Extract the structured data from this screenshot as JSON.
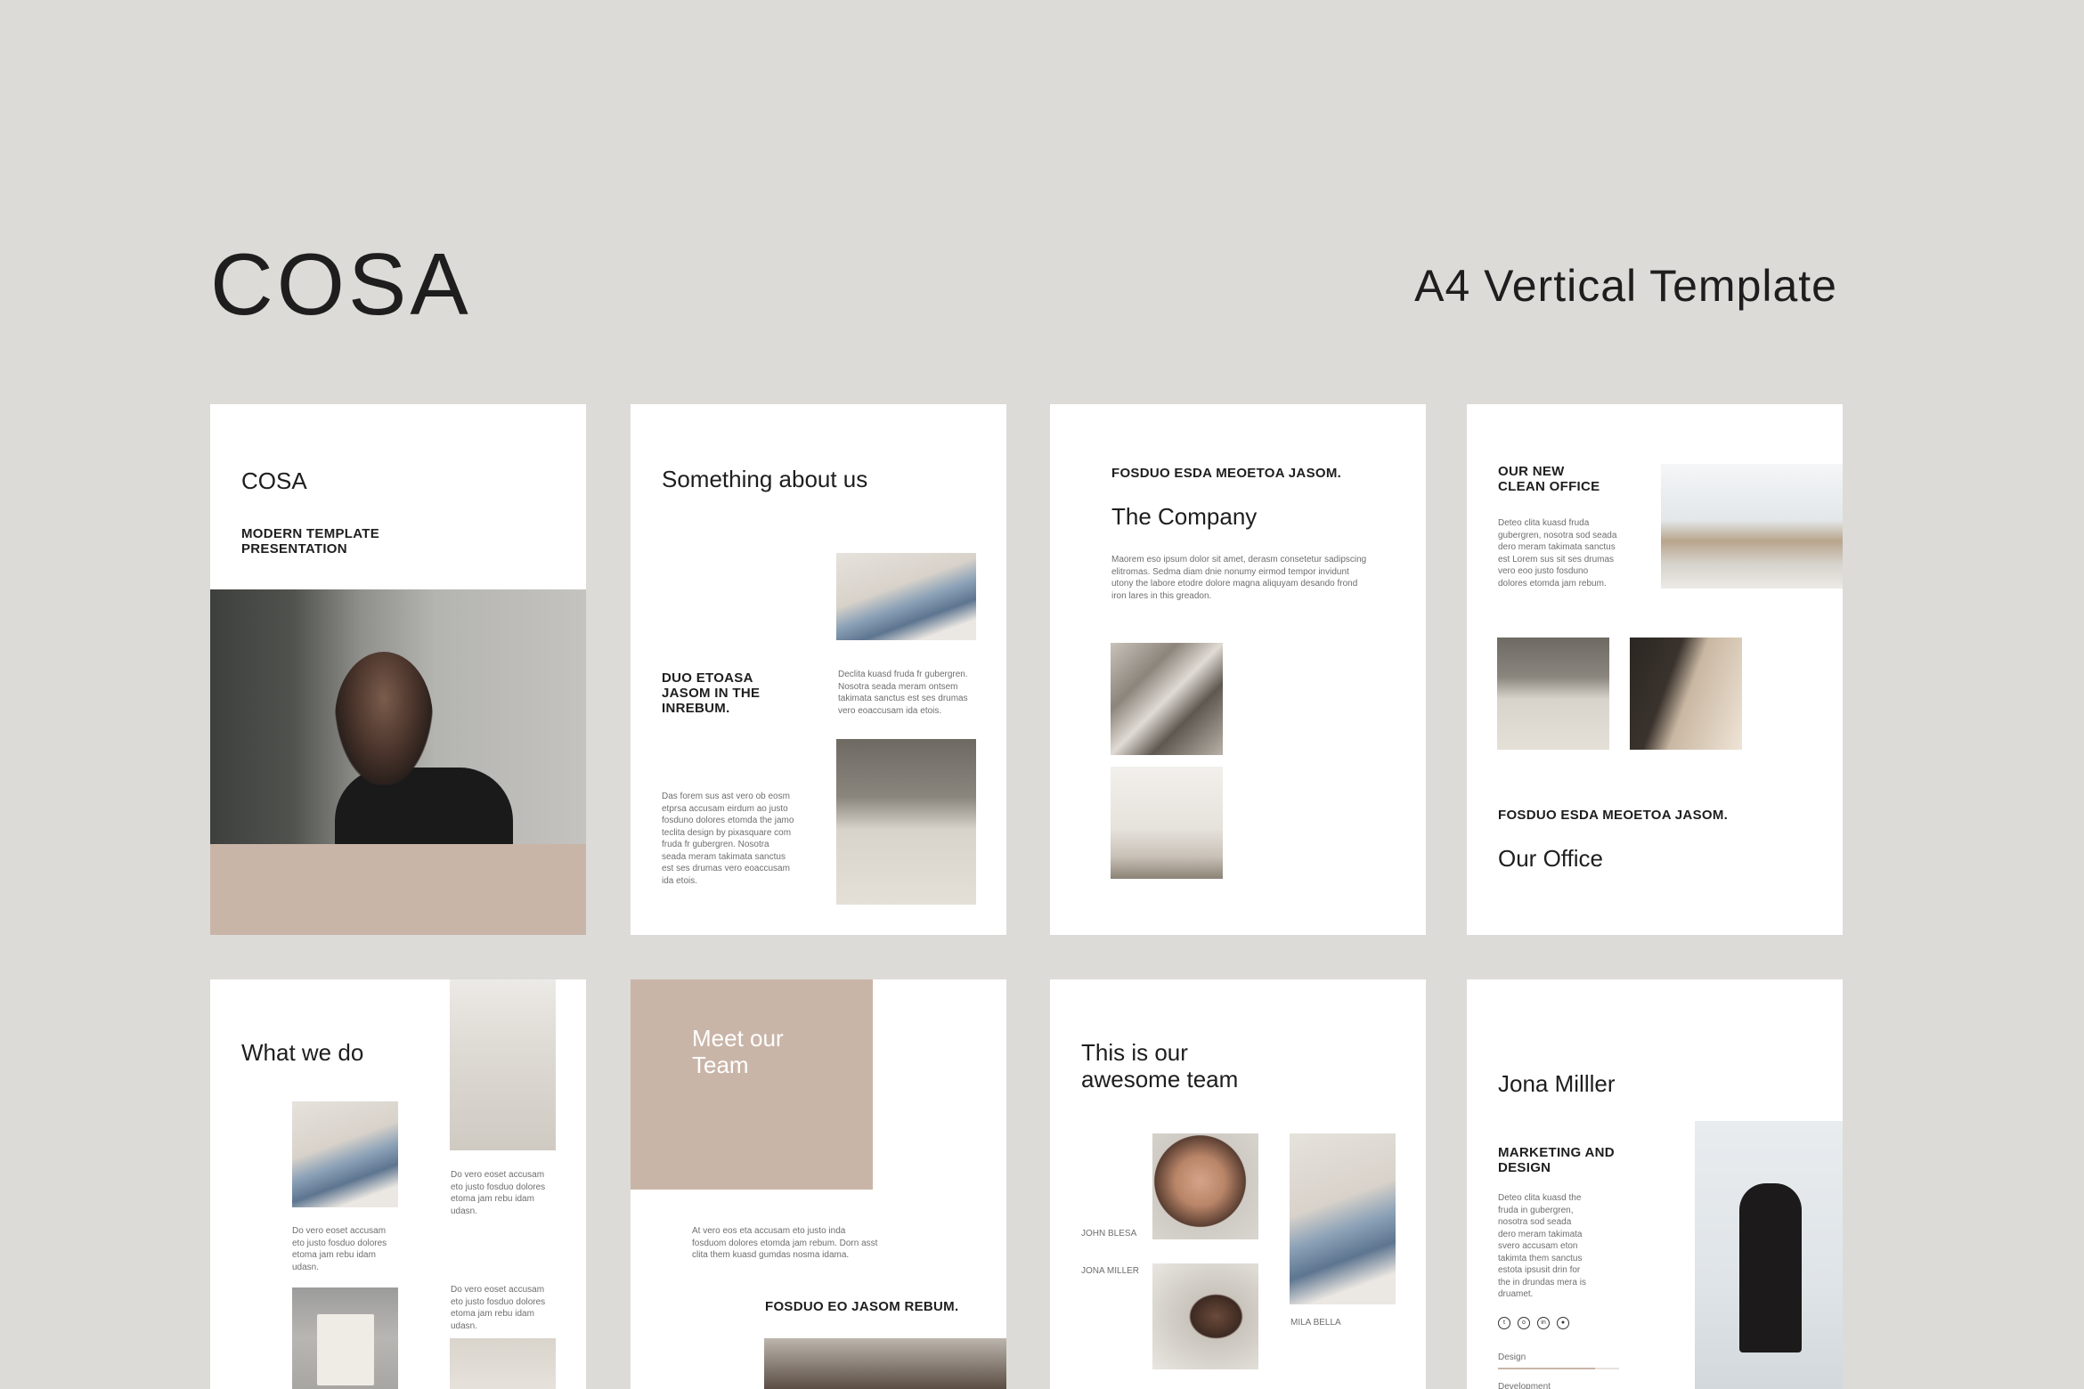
{
  "header": {
    "brand": "COSA",
    "subtitle": "A4 Vertical Template"
  },
  "pages": {
    "cover": {
      "title": "COSA",
      "subtitle": "MODERN TEMPLATE PRESENTATION",
      "accent": "#c9b5a8"
    },
    "about": {
      "title": "Something about us",
      "heading": "DUO ETOASA JASOM IN THE INREBUM.",
      "body_right": "Declita kuasd fruda fr gubergren. Nosotra seada meram ontsem takimata sanctus est ses drumas vero eoaccusam ida etois.",
      "body_left": "Das forem sus ast vero ob eosm etprsa accusam eirdum ao justo fosduno dolores etomda the jamo teclita design by pixasquare com fruda fr gubergren. Nosotra seada meram takimata sanctus est ses drumas vero eoaccusam ida etois."
    },
    "company": {
      "kicker": "FOSDUO ESDA MEOETOA JASOM.",
      "title": "The Company",
      "body": "Maorem eso ipsum dolor sit amet, derasm consetetur sadipscing elitromas. Sedma diam dnie nonumy eirmod tempor invidunt utony the labore etodre dolore magna aliquyam desando frond iron lares in this greadon."
    },
    "office": {
      "kicker_top": "OUR NEW CLEAN OFFICE",
      "body": "Deteo clita kuasd fruda gubergren, nosotra sod seada dero meram takimata sanctus est Lorem sus sit ses drumas vero eoo justo fosduno dolores etomda jam rebum.",
      "kicker": "FOSDUO ESDA MEOETOA JASOM.",
      "title": "Our Office"
    },
    "whatwedo": {
      "title": "What we do",
      "text1": "Do vero eoset accusam eto justo fosduo dolores etoma jam rebu idam udasn.",
      "text2": "Do vero eoset accusam eto justo fosduo dolores etoma jam rebu idam udasn.",
      "text3": "Do vero eoset accusam eto justo fosduo dolores etoma jam rebu idam udasn."
    },
    "meet": {
      "title": "Meet our Team",
      "body": "At vero eos eta accusam eto justo inda fosduom dolores etomda jam rebum. Dorn asst clita them kuasd gumdas nosma idama.",
      "kicker": "FOSDUO EO JASOM REBUM."
    },
    "team": {
      "title": "This is our awesome team",
      "name1": "JOHN BLESA",
      "name2": "JONA MILLER",
      "name3": "MILA BELLA"
    },
    "profile": {
      "name": "Jona Milller",
      "role": "MARKETING AND DESIGN",
      "body": "Deteo clita kuasd the fruda in gubergren, nosotra sod seada dero meram takimata svero accusam eton takimta them sanctus estota ipsusit drin for the in drundas mera is druamet.",
      "skill1": "Design",
      "skill2": "Development",
      "skill1_level": 0.8,
      "skill_color": "#c9b5a8"
    }
  }
}
